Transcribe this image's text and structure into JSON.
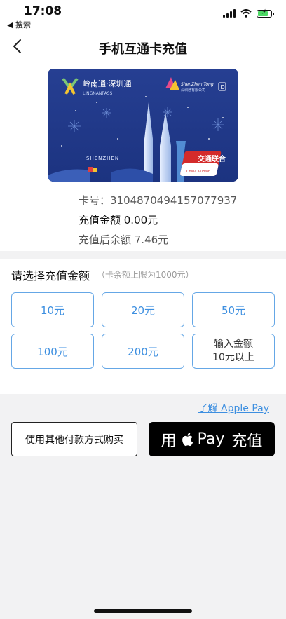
{
  "status_bar": {
    "time": "17:08",
    "back_label": "◀ 搜索"
  },
  "nav": {
    "title": "手机互通卡充值"
  },
  "card": {
    "brand_cn": "岭南通·深圳通",
    "brand_en": "LINGNANPASS",
    "city": "SHENZHEN",
    "partner": "ShenZhen Tong",
    "partner_cn": "深圳通有限公司",
    "union_cn": "交通联合",
    "union_en": "China T-union"
  },
  "info": {
    "card_no": "卡号：3104870494157077937",
    "amount": "充值金额 0.00元",
    "after_balance": "充值后余额 7.46元"
  },
  "select": {
    "title": "请选择充值金额",
    "hint": "（卡余额上限为1000元）",
    "options": [
      "10元",
      "20元",
      "50元",
      "100元",
      "200元"
    ],
    "custom_line1": "输入金额",
    "custom_line2": "10元以上"
  },
  "learn_link": "了解 Apple Pay",
  "other_pay_button": "使用其他付款方式购买",
  "apple_pay": {
    "prefix": "用",
    "pay": "Pay",
    "suffix": "充值"
  },
  "colors": {
    "accent": "#3d8fe0",
    "card_bg": "#233c8c"
  }
}
